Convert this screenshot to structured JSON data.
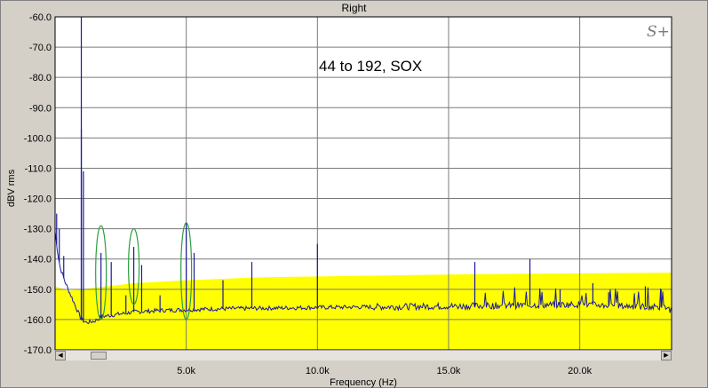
{
  "window": {
    "title": "Right"
  },
  "colors": {
    "plot_bg": "#ffffff",
    "band": "#ffff00",
    "trace": "#1a1a9c",
    "grid": "#7a7a7a",
    "ellipse": "#2e9e3e"
  },
  "scrollbar": {
    "left_arrow": "◀",
    "right_arrow": "▶"
  },
  "logo": {
    "text": "S+"
  },
  "chart_data": {
    "type": "line",
    "title": "Right",
    "annotation": "44 to 192, SOX",
    "xlabel": "Frequency (Hz)",
    "ylabel": "dBV rms",
    "xlim": [
      0,
      23500
    ],
    "ylim": [
      -170,
      -60
    ],
    "x_ticks": [
      {
        "value": 5000,
        "label": "5.0k"
      },
      {
        "value": 10000,
        "label": "10.0k"
      },
      {
        "value": 15000,
        "label": "15.0k"
      },
      {
        "value": 20000,
        "label": "20.0k"
      }
    ],
    "y_ticks": [
      {
        "value": -60,
        "label": "-60.0"
      },
      {
        "value": -70,
        "label": "-70.0"
      },
      {
        "value": -80,
        "label": "-80.0"
      },
      {
        "value": -90,
        "label": "-90.0"
      },
      {
        "value": -100,
        "label": "-100.0"
      },
      {
        "value": -110,
        "label": "-110.0"
      },
      {
        "value": -120,
        "label": "-120.0"
      },
      {
        "value": -130,
        "label": "-130.0"
      },
      {
        "value": -140,
        "label": "-140.0"
      },
      {
        "value": -150,
        "label": "-150.0"
      },
      {
        "value": -160,
        "label": "-160.0"
      },
      {
        "value": -170,
        "label": "-170.0"
      }
    ],
    "grid": true,
    "limit_band": {
      "upper": [
        [
          0,
          -149
        ],
        [
          500,
          -150.5
        ],
        [
          1000,
          -150
        ],
        [
          2000,
          -149
        ],
        [
          3000,
          -148
        ],
        [
          5000,
          -147
        ],
        [
          8000,
          -146
        ],
        [
          12000,
          -145.5
        ],
        [
          16000,
          -145
        ],
        [
          23500,
          -144.5
        ]
      ],
      "lower": -170
    },
    "noise_floor": [
      [
        0,
        -131
      ],
      [
        100,
        -138
      ],
      [
        200,
        -143
      ],
      [
        400,
        -148
      ],
      [
        600,
        -152
      ],
      [
        800,
        -156
      ],
      [
        1000,
        -160
      ],
      [
        1200,
        -161
      ],
      [
        1500,
        -160.5
      ],
      [
        1800,
        -159
      ],
      [
        2200,
        -158.5
      ],
      [
        3000,
        -157.5
      ],
      [
        4000,
        -157
      ],
      [
        6000,
        -156.5
      ],
      [
        10000,
        -156
      ],
      [
        16000,
        -155.5
      ],
      [
        20000,
        -155
      ],
      [
        23300,
        -156
      ],
      [
        23500,
        -157
      ]
    ],
    "spikes": [
      {
        "x": 60,
        "y": -125
      },
      {
        "x": 160,
        "y": -130
      },
      {
        "x": 330,
        "y": -139
      },
      {
        "x": 1000,
        "y": -60
      },
      {
        "x": 1000,
        "y": -97
      },
      {
        "x": 1080,
        "y": -111
      },
      {
        "x": 1750,
        "y": -138
      },
      {
        "x": 2140,
        "y": -141
      },
      {
        "x": 2700,
        "y": -152
      },
      {
        "x": 3000,
        "y": -136
      },
      {
        "x": 3300,
        "y": -142
      },
      {
        "x": 4000,
        "y": -152
      },
      {
        "x": 5000,
        "y": -128
      },
      {
        "x": 5300,
        "y": -138
      },
      {
        "x": 6400,
        "y": -147
      },
      {
        "x": 7500,
        "y": -141
      },
      {
        "x": 10000,
        "y": -135
      },
      {
        "x": 16000,
        "y": -141
      },
      {
        "x": 18100,
        "y": -140
      },
      {
        "x": 19250,
        "y": -150
      },
      {
        "x": 20500,
        "y": -148
      },
      {
        "x": 21100,
        "y": -151
      },
      {
        "x": 22500,
        "y": -149
      },
      {
        "x": 23100,
        "y": -150
      }
    ],
    "highlights": [
      {
        "x": 1750,
        "y_top": -129,
        "y_bottom": -160
      },
      {
        "x": 3000,
        "y_top": -130,
        "y_bottom": -155
      },
      {
        "x": 5000,
        "y_top": -128,
        "y_bottom": -160
      }
    ]
  }
}
